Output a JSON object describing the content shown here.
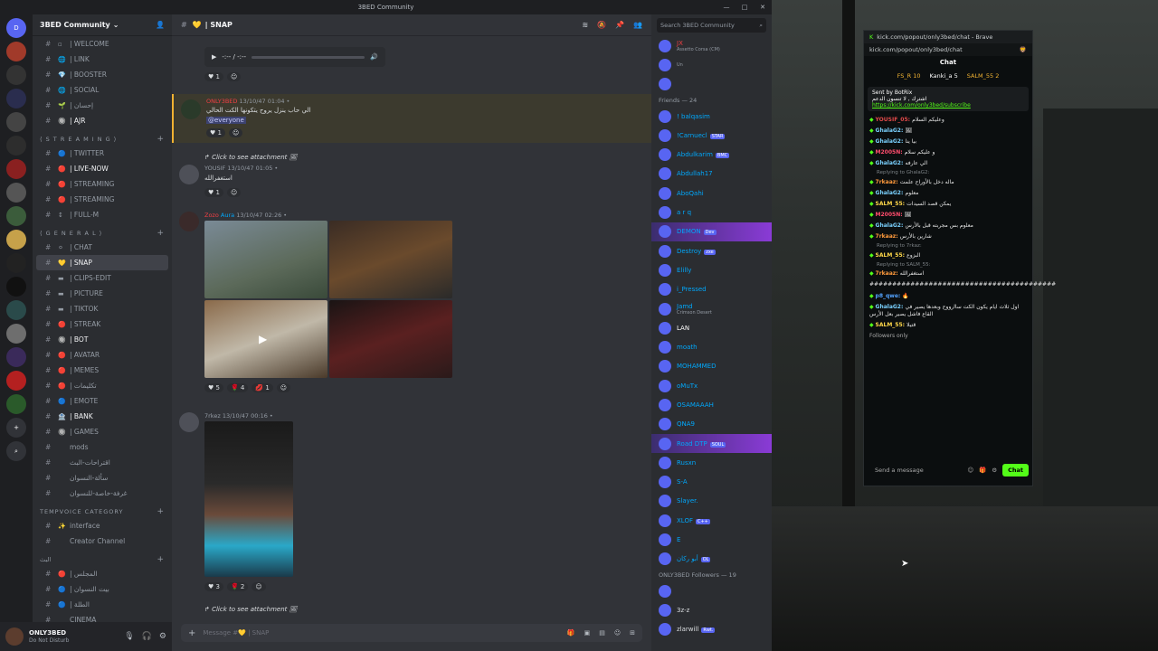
{
  "window": {
    "title": "3BED Community",
    "controls": [
      "—",
      "□",
      "✕"
    ]
  },
  "servers": [
    {
      "label": "D",
      "color": "#5865f2"
    },
    {
      "label": "",
      "color": "#a13a2a"
    },
    {
      "label": "",
      "color": "#333"
    },
    {
      "label": "",
      "color": "#2a2d4e"
    },
    {
      "label": "",
      "color": "#444"
    },
    {
      "label": "",
      "color": "#2d2d2d"
    },
    {
      "label": "",
      "color": "#8a2020"
    },
    {
      "label": "",
      "color": "#555"
    },
    {
      "label": "",
      "color": "#3b5c3b"
    },
    {
      "label": "",
      "color": "#c6a14a"
    },
    {
      "label": "",
      "color": "#222"
    },
    {
      "label": "",
      "color": "#111"
    },
    {
      "label": "",
      "color": "#2a4a4a"
    },
    {
      "label": "",
      "color": "#6e6e6e"
    },
    {
      "label": "",
      "color": "#3a2a5a"
    },
    {
      "label": "",
      "color": "#b42020"
    },
    {
      "label": "",
      "color": "#2a5a2a"
    },
    {
      "label": "+",
      "color": "#313338"
    },
    {
      "label": "⌕",
      "color": "#313338"
    }
  ],
  "sidebar": {
    "server_name": "3BED Community",
    "channels_top": [
      {
        "icon": "▫",
        "name": "| WELCOME"
      },
      {
        "icon": "🌐",
        "name": "| LINK"
      },
      {
        "icon": "💎",
        "name": "| BOOSTER"
      },
      {
        "icon": "🌐",
        "name": "| SOCIAL"
      },
      {
        "icon": "🌱",
        "name": "| إحسان"
      },
      {
        "icon": "🔘",
        "name": "| AJR",
        "bright": true
      }
    ],
    "cat_streaming": "⟨ S T R E A M I N G ⟩",
    "channels_stream": [
      {
        "icon": "🔵",
        "name": "| TWITTER"
      },
      {
        "icon": "🔴",
        "name": "| LIVE-NOW",
        "bright": true
      },
      {
        "icon": "🔴",
        "name": "| STREAMING"
      },
      {
        "icon": "🔴",
        "name": "| STREAMING"
      },
      {
        "icon": "↕",
        "name": "| FULL-M"
      }
    ],
    "cat_general": "⟨ G E N E R A L ⟩",
    "channels_general": [
      {
        "icon": "⚪",
        "name": "| CHAT"
      },
      {
        "icon": "💛",
        "name": "| SNAP",
        "active": true
      },
      {
        "icon": "▬",
        "name": "| CLIPS-EDIT"
      },
      {
        "icon": "▬",
        "name": "| PICTURE"
      },
      {
        "icon": "▬",
        "name": "| TIKTOK"
      },
      {
        "icon": "🔴",
        "name": "| STREAK"
      },
      {
        "icon": "🔘",
        "name": "| BOT",
        "bright": true
      },
      {
        "icon": "🔴",
        "name": "| AVATAR"
      },
      {
        "icon": "🔴",
        "name": "| MEMES"
      },
      {
        "icon": "🔴",
        "name": "| تكليمات"
      },
      {
        "icon": "🔵",
        "name": "| EMOTE"
      },
      {
        "icon": "🏦",
        "name": "| BANK",
        "bright": true
      },
      {
        "icon": "🔘",
        "name": "| GAMES"
      },
      {
        "icon": "",
        "name": "mods"
      },
      {
        "icon": "",
        "name": "اقتراحات-البث"
      },
      {
        "icon": "",
        "name": "سألة-النسوان"
      },
      {
        "icon": "",
        "name": "غرفة-خاصة-للنسوان"
      }
    ],
    "cat_tempvoice": "TEMPVOICE CATEGORY",
    "channels_temp": [
      {
        "icon": "✨",
        "name": "interface"
      },
      {
        "icon": "",
        "name": "Creator Channel"
      }
    ],
    "cat_voice": "البث",
    "channels_voice": [
      {
        "icon": "🔴",
        "name": "| المجلس"
      },
      {
        "icon": "🔵",
        "name": "| بيت النسوان"
      },
      {
        "icon": "🔵",
        "name": "| الطلة"
      },
      {
        "icon": "",
        "name": "CINEMA"
      }
    ],
    "user": {
      "name": "ONLY3BED",
      "status": "Do Not Disturb"
    }
  },
  "main": {
    "channel": "| SNAP",
    "input_placeholder": "Message #💛 | SNAP",
    "msg1": {
      "audio_time": "-:-- / -:--",
      "react": "♥ 1"
    },
    "msg2": {
      "name": "ONLY3BED",
      "time": "13/10/47 01:04 •",
      "text": "الي حاب ينزل يروح يتكونها الكت الحالي",
      "mention": "@everyone",
      "react": "♥ 1"
    },
    "msg3": {
      "reply": "Click to see attachment",
      "name": "YOUSIF",
      "time": "13/10/47 01:05 •",
      "text": "استغفرالله",
      "react": "♥ 1"
    },
    "msg4": {
      "name": "Zozo",
      "badge": "Aura",
      "time": "13/10/47 02:26 •",
      "r1": "♥ 5",
      "r2": "🌹 4",
      "r3": "💋 1"
    },
    "msg5": {
      "name": "7rkez",
      "time": "13/10/47 00:16 •",
      "r1": "♥ 3",
      "r2": "🌹 2"
    },
    "msg6": {
      "reply": "Click to see attachment"
    }
  },
  "members": {
    "search": "Search 3BED Community",
    "friends_cat": "Friends — 24",
    "list": [
      {
        "n": "JX",
        "c": "#f23f43",
        "s": "Assetto Corsa (CM)"
      },
      {
        "n": "",
        "c": "#a33",
        "s": "Un"
      },
      {
        "n": "",
        "c": "#ddd",
        "s": ""
      },
      {
        "n": "! balqasim",
        "c": "#00a8fc"
      },
      {
        "n": "!Carnuecl",
        "c": "#00a8fc",
        "t": "STAR"
      },
      {
        "n": "Abdulkarim",
        "c": "#00a8fc",
        "t": "BMC"
      },
      {
        "n": "Abdullah17",
        "c": "#00a8fc"
      },
      {
        "n": "AboQahi",
        "c": "#00a8fc"
      },
      {
        "n": "a r q",
        "c": "#00a8fc"
      },
      {
        "n": "DEMON",
        "c": "#00a8fc",
        "t": "Dev",
        "hl": true
      },
      {
        "n": "Destroy",
        "c": "#00a8fc",
        "t": "zxe"
      },
      {
        "n": "Elilly",
        "c": "#00a8fc"
      },
      {
        "n": "i_Pressed",
        "c": "#00a8fc"
      },
      {
        "n": "Jamd",
        "c": "#00a8fc",
        "s": "Crimson Desert"
      },
      {
        "n": "LAN",
        "c": "#fff"
      },
      {
        "n": "moath",
        "c": "#00a8fc"
      },
      {
        "n": "MOHAMMED",
        "c": "#00a8fc"
      },
      {
        "n": "oMuTx",
        "c": "#00a8fc"
      },
      {
        "n": "OSAMAAAH",
        "c": "#00a8fc"
      },
      {
        "n": "QNA9",
        "c": "#00a8fc"
      },
      {
        "n": "Road DTP",
        "c": "#00a8fc",
        "t": "SOUL",
        "hl": true
      },
      {
        "n": "Rusxn",
        "c": "#00a8fc"
      },
      {
        "n": "S-A",
        "c": "#00a8fc"
      },
      {
        "n": "Slayer.",
        "c": "#00a8fc"
      },
      {
        "n": "XLOF",
        "c": "#00a8fc",
        "t": "C++"
      },
      {
        "n": "E",
        "c": "#00a8fc"
      },
      {
        "n": "أبو ركان",
        "c": "#00a8fc",
        "t": "OL"
      }
    ],
    "followers_cat": "ONLY3BED Followers — 19",
    "followers": [
      {
        "n": "",
        "c": "#f23f43"
      },
      {
        "n": "3z-z",
        "c": "#dbdee1"
      },
      {
        "n": "zlarwill",
        "c": "#dbdee1",
        "t": "Rwt."
      }
    ]
  },
  "kick": {
    "window_title": "kick.com/popout/only3bed/chat - Brave",
    "url": "kick.com/popout/only3bed/chat",
    "title": "Chat",
    "lb1": "FS_R 10",
    "lb2": "Kanki_a 5",
    "lb3": "SALM_55 2",
    "pin_by": "Sent by  BotRix",
    "pin_text": "اشترك , لا تنسون الدعم",
    "pin_link": "https://kick.com/only3bed/subscribe",
    "messages": [
      {
        "u": "YOUSIF_05:",
        "c": "#e24a4a",
        "t": "وعليكم السلام"
      },
      {
        "u": "GhalaG2:",
        "c": "#7ad1ff",
        "t": "🖼"
      },
      {
        "u": "GhalaG2:",
        "c": "#7ad1ff",
        "t": "بيا ينا"
      },
      {
        "u": "M2005N:",
        "c": "#ff4d6d",
        "t": "و عليكم سلام"
      },
      {
        "u": "GhalaG2:",
        "c": "#7ad1ff",
        "t": "الي عارفه"
      },
      {
        "reply": "Replying to GhalaG2:"
      },
      {
        "u": "7rkaaz:",
        "c": "#ff9a3c",
        "t": "ماله دخل بالأوراح علمت"
      },
      {
        "u": "GhalaG2:",
        "c": "#7ad1ff",
        "t": "معلوم"
      },
      {
        "u": "SALM_55:",
        "c": "#ffd84a",
        "t": "يمكن قصد السيدات"
      },
      {
        "u": "M2005N:",
        "c": "#ff4d6d",
        "t": "🖼"
      },
      {
        "u": "GhalaG2:",
        "c": "#7ad1ff",
        "t": "معلوم بس مجربته قبل بالأرس"
      },
      {
        "u": "7rkaaz:",
        "c": "#ff9a3c",
        "t": "شارين بالأرس"
      },
      {
        "reply": "Replying to 7rkaz:"
      },
      {
        "u": "SALM_55:",
        "c": "#ffd84a",
        "t": "البزوع"
      },
      {
        "reply": "Replying to SALM_55:"
      },
      {
        "u": "7rkaaz:",
        "c": "#ff9a3c",
        "t": "استغفرالله"
      },
      {
        "u": "",
        "c": "#fff",
        "t": "#########################################"
      },
      {
        "u": "p8_qwe:",
        "c": "#53a3ff",
        "t": "🔥"
      },
      {
        "u": "GhalaG2:",
        "c": "#7ad1ff",
        "t": "اول ثلاث ايام يكون الكت ساارووح وبعدها يصير في القاع فاشل يصير بعل الأرس"
      },
      {
        "u": "SALM_55:",
        "c": "#ffd84a",
        "t": "قتيلا"
      }
    ],
    "followers_only": "Followers only",
    "send_placeholder": "Send a message",
    "chat_button": "Chat"
  }
}
